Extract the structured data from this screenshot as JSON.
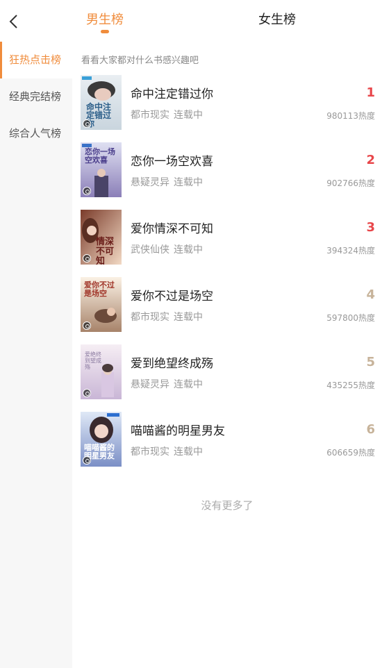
{
  "header": {
    "tabs": [
      {
        "label": "男生榜",
        "active": true
      },
      {
        "label": "女生榜",
        "active": false
      }
    ],
    "accent_color": "#f08c3c"
  },
  "sidebar": {
    "items": [
      {
        "label": "狂热点击榜",
        "active": true
      },
      {
        "label": "经典完结榜",
        "active": false
      },
      {
        "label": "综合人气榜",
        "active": false
      }
    ]
  },
  "main": {
    "subtitle": "看看大家都对什么书感兴趣吧",
    "books": [
      {
        "rank": "1",
        "title": "命中注定错过你",
        "genre": "都市现实",
        "status": "连载中",
        "heat": "980113热度",
        "cover_text": "命中注定错过你"
      },
      {
        "rank": "2",
        "title": "恋你一场空欢喜",
        "genre": "悬疑灵异",
        "status": "连载中",
        "heat": "902766热度",
        "cover_text": "恋你一场空欢喜"
      },
      {
        "rank": "3",
        "title": "爱你情深不可知",
        "genre": "武侠仙侠",
        "status": "连载中",
        "heat": "394324热度",
        "cover_text": "情深不可知"
      },
      {
        "rank": "4",
        "title": "爱你不过是场空",
        "genre": "都市现实",
        "status": "连载中",
        "heat": "597800热度",
        "cover_text": "爱你不过是场空"
      },
      {
        "rank": "5",
        "title": "爱到绝望终成殇",
        "genre": "悬疑灵异",
        "status": "连载中",
        "heat": "435255热度",
        "cover_text": "爱绝终到望成殇"
      },
      {
        "rank": "6",
        "title": "喵喵酱的明星男友",
        "genre": "都市现实",
        "status": "连载中",
        "heat": "606659热度",
        "cover_text": "喵喵酱的明星男友"
      }
    ],
    "footer": "没有更多了",
    "rank_colors": {
      "top": "#e8474b",
      "other": "#c7b39a"
    }
  }
}
